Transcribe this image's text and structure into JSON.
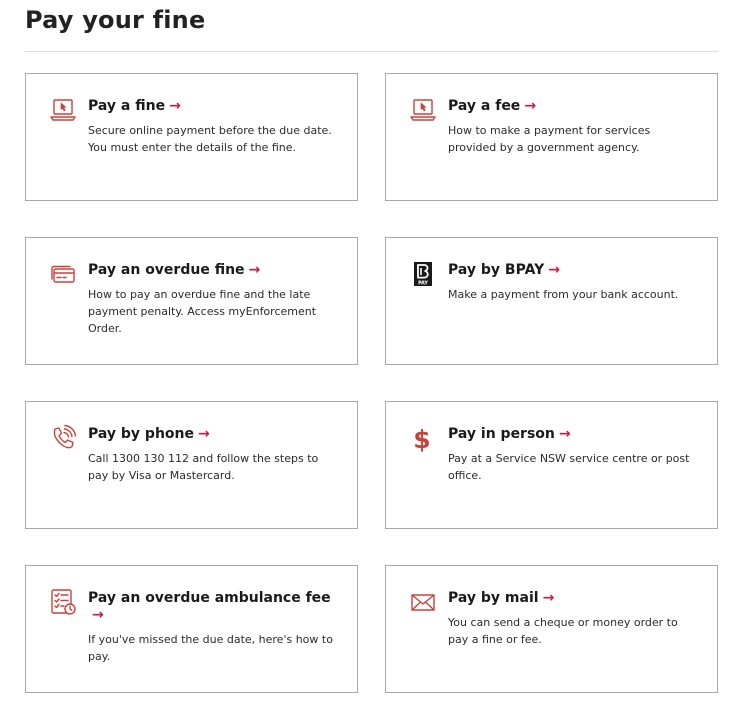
{
  "page": {
    "title": "Pay your fine"
  },
  "colors": {
    "accent": "#d7153a",
    "icon": "#c8423c",
    "border": "#a8a8a8"
  },
  "cards": [
    {
      "title": "Pay a fine",
      "arrow": "→",
      "icon": "laptop-cursor-icon",
      "description": "Secure online payment before the due date. You must enter the details of the fine."
    },
    {
      "title": "Pay a fee",
      "arrow": "→",
      "icon": "laptop-cursor-icon",
      "description": "How to make a payment for services provided by a government agency."
    },
    {
      "title": "Pay an overdue fine",
      "arrow": "→",
      "icon": "credit-card-icon",
      "description": "How to pay an overdue fine and the late payment penalty. Access myEnforcement Order."
    },
    {
      "title": "Pay by BPAY",
      "arrow": "→",
      "icon": "bpay-logo-icon",
      "description": "Make a payment from your bank account."
    },
    {
      "title": "Pay by phone",
      "arrow": "→",
      "icon": "phone-ringing-icon",
      "description": "Call 1300 130 112 and follow the steps to pay by Visa or Mastercard."
    },
    {
      "title": "Pay in person",
      "arrow": "→",
      "icon": "dollar-sign-icon",
      "description": "Pay at a Service NSW service centre or post office."
    },
    {
      "title": "Pay an overdue ambulance fee",
      "arrow": "→",
      "icon": "checklist-clock-icon",
      "description": "If you've missed the due date, here's how to pay."
    },
    {
      "title": "Pay by mail",
      "arrow": "→",
      "icon": "envelope-icon",
      "description": "You can send a cheque or money order to pay a fine or fee."
    }
  ]
}
